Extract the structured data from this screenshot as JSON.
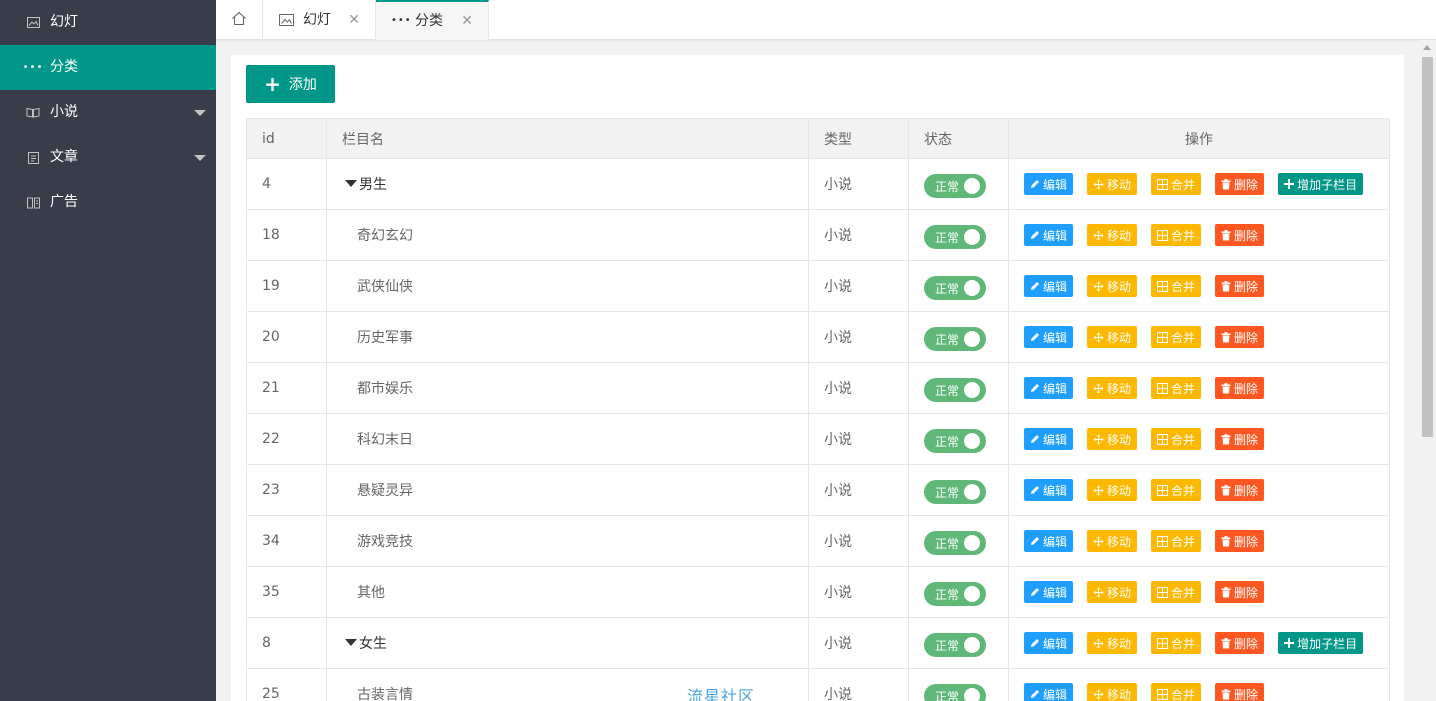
{
  "sidebar": {
    "items": [
      {
        "label": "幻灯",
        "icon": "image-icon",
        "active": false,
        "expandable": false
      },
      {
        "label": "分类",
        "icon": "more-icon",
        "active": true,
        "expandable": false
      },
      {
        "label": "小说",
        "icon": "book-icon",
        "active": false,
        "expandable": true
      },
      {
        "label": "文章",
        "icon": "document-icon",
        "active": false,
        "expandable": true
      },
      {
        "label": "广告",
        "icon": "ad-icon",
        "active": false,
        "expandable": false
      }
    ]
  },
  "tabs": {
    "home_icon": "home-icon",
    "items": [
      {
        "label": "幻灯",
        "icon": "image-icon",
        "active": false
      },
      {
        "label": "分类",
        "icon": "more-icon",
        "active": true
      }
    ],
    "close_glyph": "✕"
  },
  "toolbar": {
    "add_label": "添加"
  },
  "table": {
    "headers": {
      "id": "id",
      "name": "栏目名",
      "type": "类型",
      "status": "状态",
      "ops": "操作"
    },
    "rows": [
      {
        "id": "4",
        "name": "男生",
        "parent": true,
        "type": "小说",
        "status": "正常"
      },
      {
        "id": "18",
        "name": "奇幻玄幻",
        "parent": false,
        "type": "小说",
        "status": "正常"
      },
      {
        "id": "19",
        "name": "武侠仙侠",
        "parent": false,
        "type": "小说",
        "status": "正常"
      },
      {
        "id": "20",
        "name": "历史军事",
        "parent": false,
        "type": "小说",
        "status": "正常"
      },
      {
        "id": "21",
        "name": "都市娱乐",
        "parent": false,
        "type": "小说",
        "status": "正常"
      },
      {
        "id": "22",
        "name": "科幻末日",
        "parent": false,
        "type": "小说",
        "status": "正常"
      },
      {
        "id": "23",
        "name": "悬疑灵异",
        "parent": false,
        "type": "小说",
        "status": "正常"
      },
      {
        "id": "34",
        "name": "游戏竞技",
        "parent": false,
        "type": "小说",
        "status": "正常"
      },
      {
        "id": "35",
        "name": "其他",
        "parent": false,
        "type": "小说",
        "status": "正常"
      },
      {
        "id": "8",
        "name": "女生",
        "parent": true,
        "type": "小说",
        "status": "正常"
      },
      {
        "id": "25",
        "name": "古装言情",
        "parent": false,
        "type": "小说",
        "status": "正常"
      }
    ],
    "actions": {
      "edit": "编辑",
      "move": "移动",
      "merge": "合并",
      "delete": "删除",
      "add_child": "增加子栏目"
    }
  },
  "watermark": "流星社区",
  "colors": {
    "sidebar_bg": "#393d49",
    "accent": "#009688",
    "switch_on": "#5fb878",
    "edit_blue": "#1e9fff",
    "warn_yellow": "#ffb800",
    "danger_red": "#ff5722"
  }
}
